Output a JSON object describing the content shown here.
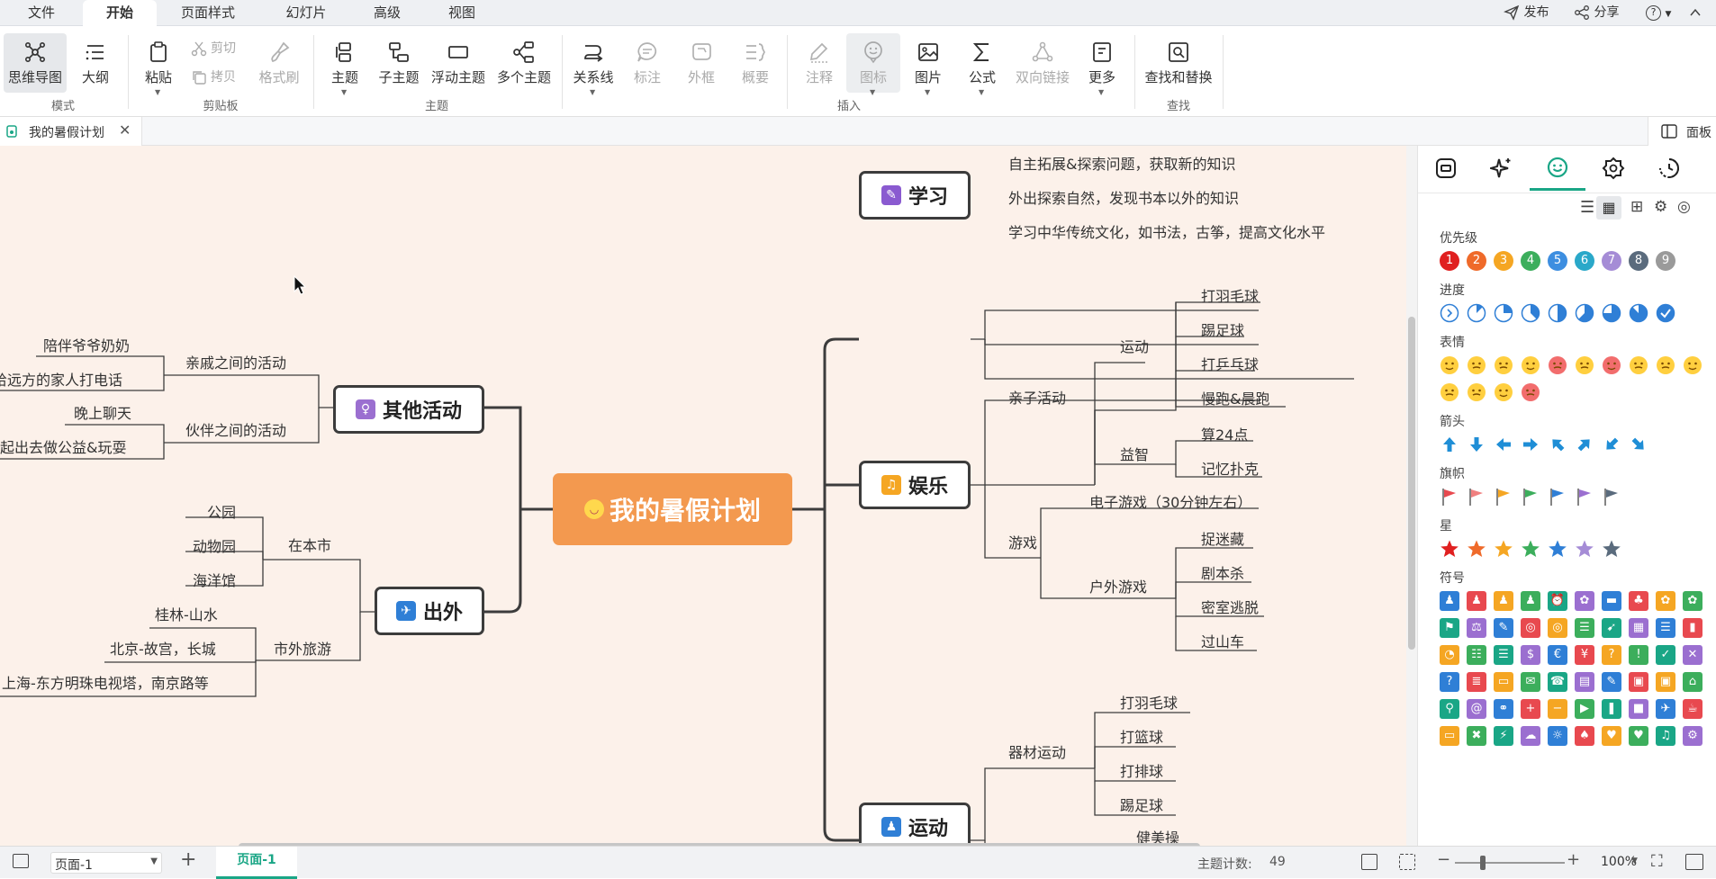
{
  "menubar": {
    "items": [
      "文件",
      "开始",
      "页面样式",
      "幻灯片",
      "高级",
      "视图"
    ],
    "publish": "发布",
    "share": "分享",
    "help": "?"
  },
  "ribbon": {
    "mode": {
      "mindmap": "思维导图",
      "outline": "大纲",
      "group": "模式"
    },
    "clipboard": {
      "paste": "粘贴",
      "cut": "剪切",
      "copy": "拷贝",
      "format_painter": "格式刷",
      "group": "剪贴板"
    },
    "topic": {
      "topic": "主题",
      "subtopic": "子主题",
      "floating": "浮动主题",
      "multiple": "多个主题",
      "group": "主题"
    },
    "insert": {
      "relation": "关系线",
      "callout": "标注",
      "boundary": "外框",
      "summary": "概要",
      "note": "注释",
      "icon": "图标",
      "image": "图片",
      "formula": "公式",
      "bilink": "双向链接",
      "more": "更多",
      "group": "插入"
    },
    "find": {
      "find_replace": "查找和替换",
      "group": "查找"
    }
  },
  "tabbar": {
    "doc_title": "我的暑假计划",
    "panel": "面板"
  },
  "mindmap": {
    "central": "我的暑假计划",
    "branches": {
      "study": "学习",
      "fun": "娱乐",
      "sport": "运动",
      "other": "其他活动",
      "travel": "出外"
    },
    "study_items": [
      "自主拓展&探索问题，获取新的知识",
      "外出探索自然，发现书本以外的知识",
      "学习中华传统文化，如书法，古筝，提高文化水平"
    ],
    "fun": {
      "parent_child": "亲子活动",
      "sport": "运动",
      "sport_items": [
        "打羽毛球",
        "踢足球",
        "打乒乓球",
        "慢跑&晨跑"
      ],
      "puzzle": "益智",
      "puzzle_items": [
        "算24点",
        "记忆扑克"
      ],
      "games": "游戏",
      "video_game": "电子游戏（30分钟左右）",
      "outdoor": "户外游戏",
      "outdoor_items": [
        "捉迷藏",
        "剧本杀",
        "密室逃脱",
        "过山车"
      ]
    },
    "sport": {
      "equipment": "器材运动",
      "items": [
        "打羽毛球",
        "打篮球",
        "打排球",
        "踢足球"
      ],
      "fitness": "健美操"
    },
    "other": {
      "relatives": "亲戚之间的活动",
      "relatives_items": [
        "陪伴爷爷奶奶",
        "给远方的家人打电话"
      ],
      "friends": "伙伴之间的活动",
      "friends_items": [
        "晚上聊天",
        "一起出去做公益&玩耍"
      ]
    },
    "travel": {
      "city": "在本市",
      "city_items": [
        "公园",
        "动物园",
        "海洋馆"
      ],
      "out": "市外旅游",
      "out_items": [
        "桂林-山水",
        "北京-故宫，长城",
        "上海-东方明珠电视塔，南京路等"
      ]
    }
  },
  "panel": {
    "priority": "优先级",
    "progress": "进度",
    "emoji": "表情",
    "arrow": "箭头",
    "flag": "旗帜",
    "star": "星",
    "symbol": "符号",
    "priority_nums": [
      "1",
      "2",
      "3",
      "4",
      "5",
      "6",
      "7",
      "8",
      "9"
    ]
  },
  "status": {
    "page_select": "页面-1",
    "page_tab": "页面-1",
    "topic_count_label": "主题计数:",
    "topic_count": "49",
    "zoom": "100%"
  },
  "colors": {
    "accent": "#1aa686",
    "central": "#f3994f",
    "canvas": "#fcf1ea",
    "priority": [
      "#e02020",
      "#ef6a2a",
      "#f5a623",
      "#3cae5c",
      "#3d8ee0",
      "#2aa8c9",
      "#a58cd6",
      "#5a6b7d",
      "#9a9a9a"
    ],
    "marker_palette": [
      "#2f7fd6",
      "#e8494f",
      "#f5a623",
      "#3cae5c",
      "#1aa686",
      "#9b6fd0"
    ]
  }
}
